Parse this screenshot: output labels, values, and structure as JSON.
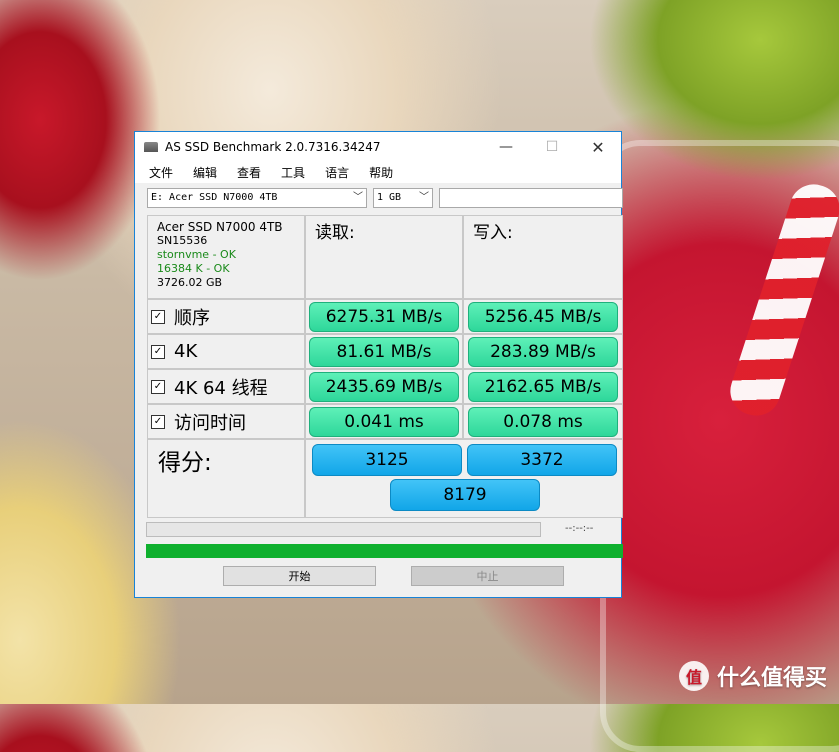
{
  "window": {
    "title": "AS SSD Benchmark 2.0.7316.34247"
  },
  "menu": [
    "文件",
    "编辑",
    "查看",
    "工具",
    "语言",
    "帮助"
  ],
  "toolbar": {
    "drive": "E: Acer SSD N7000 4TB",
    "size": "1 GB",
    "input_value": ""
  },
  "info": {
    "name": "Acer SSD N7000 4TB",
    "serial": "SN15536",
    "driver": "stornvme - OK",
    "alignment": "16384 K - OK",
    "capacity": "3726.02 GB"
  },
  "headers": {
    "read": "读取:",
    "write": "写入:"
  },
  "rows": [
    {
      "label": "顺序",
      "checked": true,
      "read": "6275.31 MB/s",
      "write": "5256.45 MB/s"
    },
    {
      "label": "4K",
      "checked": true,
      "read": "81.61 MB/s",
      "write": "283.89 MB/s"
    },
    {
      "label": "4K 64 线程",
      "checked": true,
      "read": "2435.69 MB/s",
      "write": "2162.65 MB/s"
    },
    {
      "label": "访问时间",
      "checked": true,
      "read": "0.041 ms",
      "write": "0.078 ms"
    }
  ],
  "score": {
    "label": "得分:",
    "read": "3125",
    "write": "3372",
    "total": "8179"
  },
  "status": {
    "time": "--:--:--",
    "progress": 0,
    "complete_bar": 1.0
  },
  "buttons": {
    "start": "开始",
    "stop": "中止"
  },
  "watermark": {
    "logo": "值",
    "text": "什么值得买"
  },
  "colors": {
    "accent": "#1883d7",
    "result_green": "#2ed79a",
    "score_blue": "#11a6e8",
    "ok_green": "#1a8a1a",
    "bar_green": "#0fb02e"
  }
}
